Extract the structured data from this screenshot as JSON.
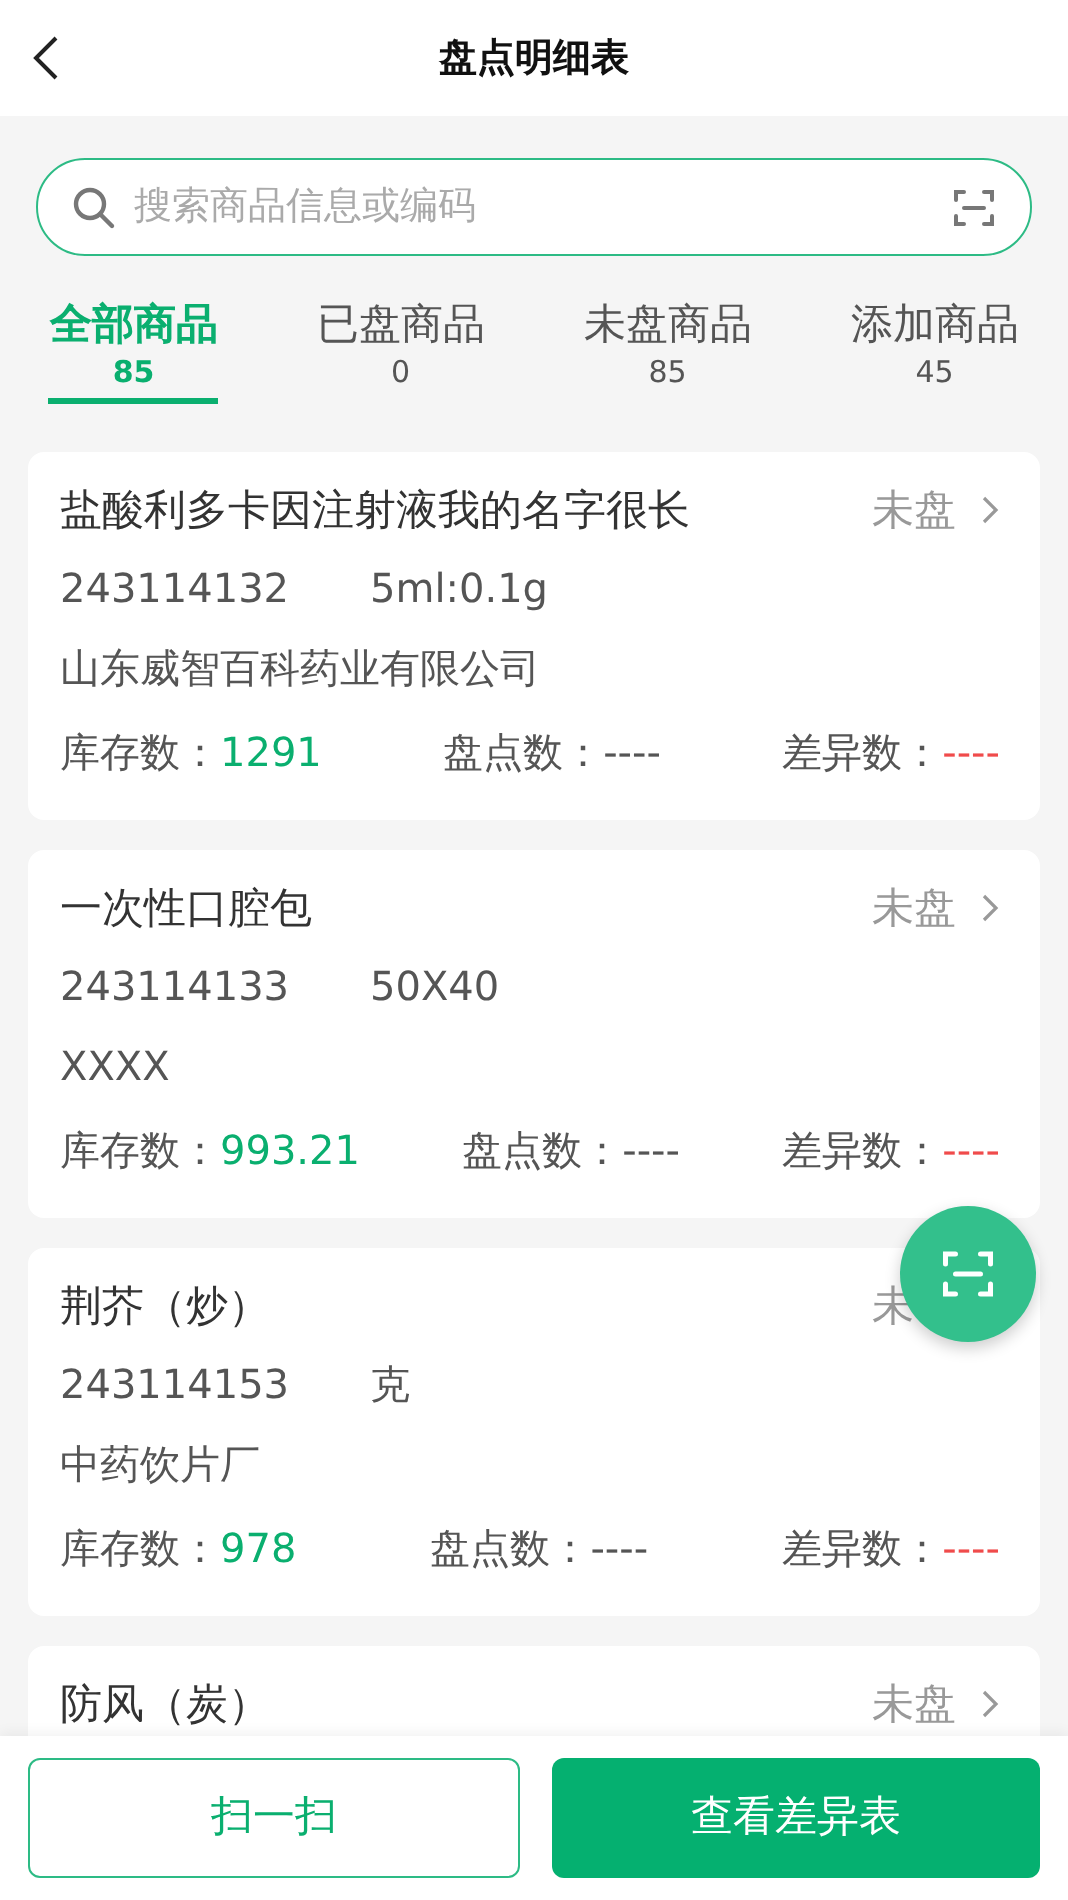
{
  "header": {
    "title": "盘点明细表"
  },
  "search": {
    "placeholder": "搜索商品信息或编码"
  },
  "tabs": [
    {
      "label": "全部商品",
      "count": "85",
      "selected": true
    },
    {
      "label": "已盘商品",
      "count": "0",
      "selected": false
    },
    {
      "label": "未盘商品",
      "count": "85",
      "selected": false
    },
    {
      "label": "添加商品",
      "count": "45",
      "selected": false
    }
  ],
  "items": [
    {
      "name": "盐酸利多卡因注射液我的名字很长",
      "status": "未盘",
      "chevron": true,
      "code": "243114132",
      "spec": "5ml:0.1g",
      "maker": "山东威智百科药业有限公司",
      "stock_label": "库存数：",
      "stock": "1291",
      "count_label": "盘点数：",
      "count": "----",
      "diff_label": "差异数：",
      "diff": "----"
    },
    {
      "name": "一次性口腔包",
      "status": "未盘",
      "chevron": true,
      "code": "243114133",
      "spec": "50X40",
      "maker": "XXXX",
      "stock_label": "库存数：",
      "stock": "993.21",
      "count_label": "盘点数：",
      "count": "----",
      "diff_label": "差异数：",
      "diff": "----"
    },
    {
      "name": "荆芥（炒）",
      "status": "未",
      "chevron": false,
      "code": "243114153",
      "spec": "克",
      "maker": "中药饮片厂",
      "stock_label": "库存数：",
      "stock": "978",
      "count_label": "盘点数：",
      "count": "----",
      "diff_label": "差异数：",
      "diff": "----"
    },
    {
      "name": "防风（炭）",
      "status": "未盘",
      "chevron": true
    }
  ],
  "buttons": {
    "scan": "扫一扫",
    "diff_table": "查看差异表"
  }
}
